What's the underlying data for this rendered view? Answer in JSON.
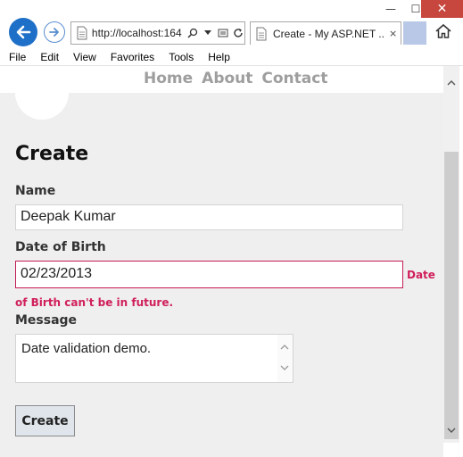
{
  "browser": {
    "address": "http://localhost:164",
    "tab_title": "Create - My ASP.NET ...",
    "tab_close": "×",
    "menu": [
      "File",
      "Edit",
      "View",
      "Favorites",
      "Tools",
      "Help"
    ],
    "window_buttons": {
      "minimize": "—",
      "maximize": "☐",
      "close": "✕"
    }
  },
  "site_nav": {
    "links": [
      "Home",
      "About",
      "Contact"
    ]
  },
  "form": {
    "title": "Create",
    "name_label": "Name",
    "name_value": "Deepak Kumar",
    "dob_label": "Date of Birth",
    "dob_value": "02/23/2013",
    "dob_error_part1": "Date",
    "dob_error_part2": "of Birth can't be in future.",
    "message_label": "Message",
    "message_value": "Date validation demo.",
    "submit_label": "Create"
  },
  "colors": {
    "error": "#d01f5a",
    "back_button": "#1e6fc7",
    "nav_link": "#9e9e9e"
  }
}
